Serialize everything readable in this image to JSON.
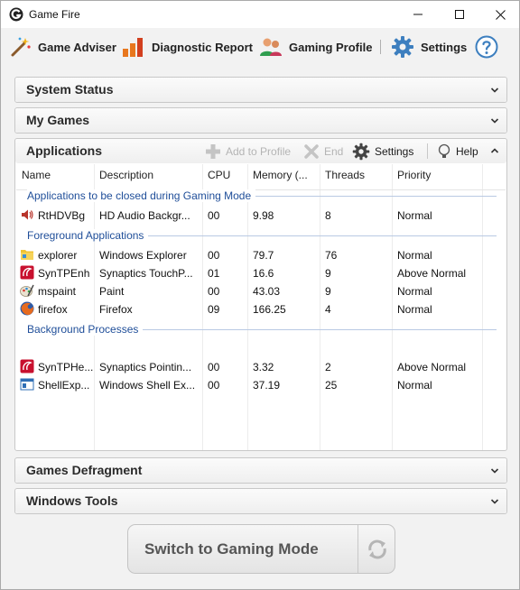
{
  "window": {
    "title": "Game Fire"
  },
  "toolbar": {
    "items": [
      {
        "label": "Game Adviser",
        "icon": "magic-wand-icon"
      },
      {
        "label": "Diagnostic Report",
        "icon": "bar-chart-icon"
      },
      {
        "label": "Gaming Profile",
        "icon": "users-icon"
      },
      {
        "label": "Settings",
        "icon": "gear-icon"
      }
    ],
    "help_icon": "help-icon"
  },
  "panels": {
    "system_status": "System Status",
    "my_games": "My Games",
    "applications": "Applications",
    "games_defragment": "Games Defragment",
    "windows_tools": "Windows Tools"
  },
  "applications": {
    "actions": {
      "add_to_profile": "Add to Profile",
      "end": "End",
      "settings": "Settings",
      "help": "Help"
    },
    "columns": [
      "Name",
      "Description",
      "CPU",
      "Memory (...",
      "Threads",
      "Priority"
    ],
    "groups": [
      {
        "label": "Applications to be closed during Gaming Mode",
        "rows": [
          {
            "name": "RtHDVBg",
            "description": "HD Audio Backgr...",
            "cpu": "00",
            "memory": "9.98",
            "threads": "8",
            "priority": "Normal",
            "icon": "speaker-icon"
          }
        ]
      },
      {
        "label": "Foreground Applications",
        "rows": [
          {
            "name": "explorer",
            "description": "Windows Explorer",
            "cpu": "00",
            "memory": "79.7",
            "threads": "76",
            "priority": "Normal",
            "icon": "folder-icon"
          },
          {
            "name": "SynTPEnh",
            "description": "Synaptics TouchP...",
            "cpu": "01",
            "memory": "16.6",
            "threads": "9",
            "priority": "Above Normal",
            "icon": "synaptics-icon"
          },
          {
            "name": "mspaint",
            "description": "Paint",
            "cpu": "00",
            "memory": "43.03",
            "threads": "9",
            "priority": "Normal",
            "icon": "paint-icon"
          },
          {
            "name": "firefox",
            "description": "Firefox",
            "cpu": "09",
            "memory": "166.25",
            "threads": "4",
            "priority": "Normal",
            "icon": "firefox-icon"
          }
        ]
      },
      {
        "label": "Background Processes",
        "rows": [
          {
            "name": "SynTPHe...",
            "description": "Synaptics Pointin...",
            "cpu": "00",
            "memory": "3.32",
            "threads": "2",
            "priority": "Above Normal",
            "icon": "synaptics-icon"
          },
          {
            "name": "ShellExp...",
            "description": "Windows Shell Ex...",
            "cpu": "00",
            "memory": "37.19",
            "threads": "25",
            "priority": "Normal",
            "icon": "window-icon"
          }
        ]
      }
    ]
  },
  "gaming_mode": {
    "label": "Switch to Gaming Mode",
    "icon": "refresh-icon"
  },
  "colors": {
    "group_text": "#1f4e99",
    "accent_blue": "#2f7cc4",
    "chart_orange": "#e8771e"
  }
}
